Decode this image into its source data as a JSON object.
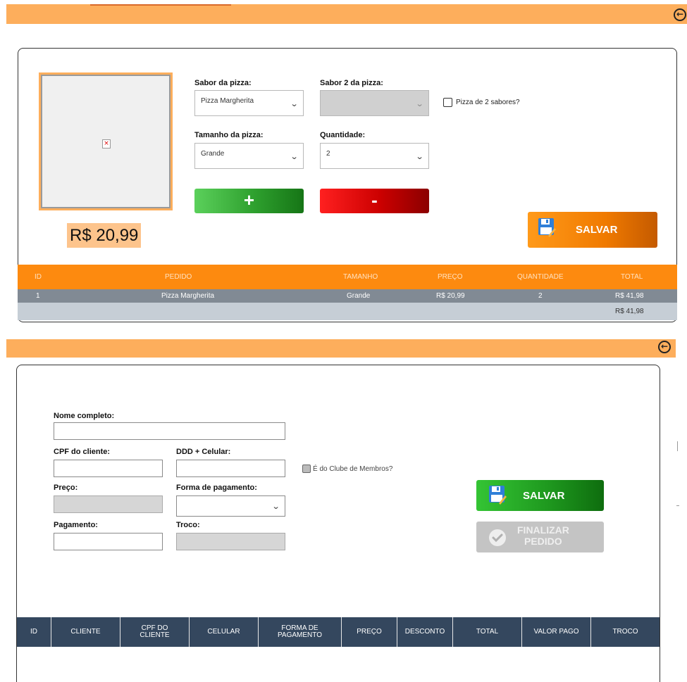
{
  "colors": {
    "accent_orange": "#fdae5c",
    "table_orange": "#fd8a0f",
    "table_dark": "#34475e",
    "save_green": "#1f9a1f",
    "minus_red": "#cc0000"
  },
  "order_panel": {
    "back_icon": "circle-arrow-left-icon",
    "image_alt": "broken-image-icon",
    "price": "R$ 20,99",
    "flavor_label": "Sabor da pizza:",
    "flavor_value": "Pizza Margherita",
    "flavor2_label": "Sabor 2 da pizza:",
    "flavor2_value": "",
    "two_flavors_label": "Pizza de 2 sabores?",
    "size_label": "Tamanho da pizza:",
    "size_value": "Grande",
    "quantity_label": "Quantidade:",
    "quantity_value": "2",
    "plus_label": "+",
    "minus_label": "-",
    "save_label": "SALVAR"
  },
  "order_table": {
    "headers": [
      "ID",
      "PEDIDO",
      "TAMANHO",
      "PREÇO",
      "QUANTIDADE",
      "TOTAL"
    ],
    "rows": [
      [
        "1",
        "Pizza Margherita",
        "Grande",
        "R$ 20,99",
        "2",
        "R$ 41,98"
      ]
    ],
    "footer_total": "R$ 41,98"
  },
  "customer_panel": {
    "back_icon": "circle-arrow-left-icon",
    "full_name_label": "Nome completo:",
    "cpf_label": "CPF do cliente:",
    "phone_label": "DDD + Celular:",
    "member_label": "É do Clube de Membros?",
    "price_label": "Preço:",
    "payment_method_label": "Forma de pagamento:",
    "payment_label": "Pagamento:",
    "change_label": "Troco:",
    "save_label": "SALVAR",
    "finalize_line1": "FINALIZAR",
    "finalize_line2": "PEDIDO"
  },
  "customer_table": {
    "headers": [
      {
        "line1": "ID",
        "line2": ""
      },
      {
        "line1": "CLIENTE",
        "line2": ""
      },
      {
        "line1": "CPF DO",
        "line2": "CLIENTE"
      },
      {
        "line1": "CELULAR",
        "line2": ""
      },
      {
        "line1": "FORMA DE",
        "line2": "PAGAMENTO"
      },
      {
        "line1": "PREÇO",
        "line2": ""
      },
      {
        "line1": "DESCONTO",
        "line2": ""
      },
      {
        "line1": "TOTAL",
        "line2": ""
      },
      {
        "line1": "VALOR PAGO",
        "line2": ""
      },
      {
        "line1": "TROCO",
        "line2": ""
      }
    ]
  }
}
